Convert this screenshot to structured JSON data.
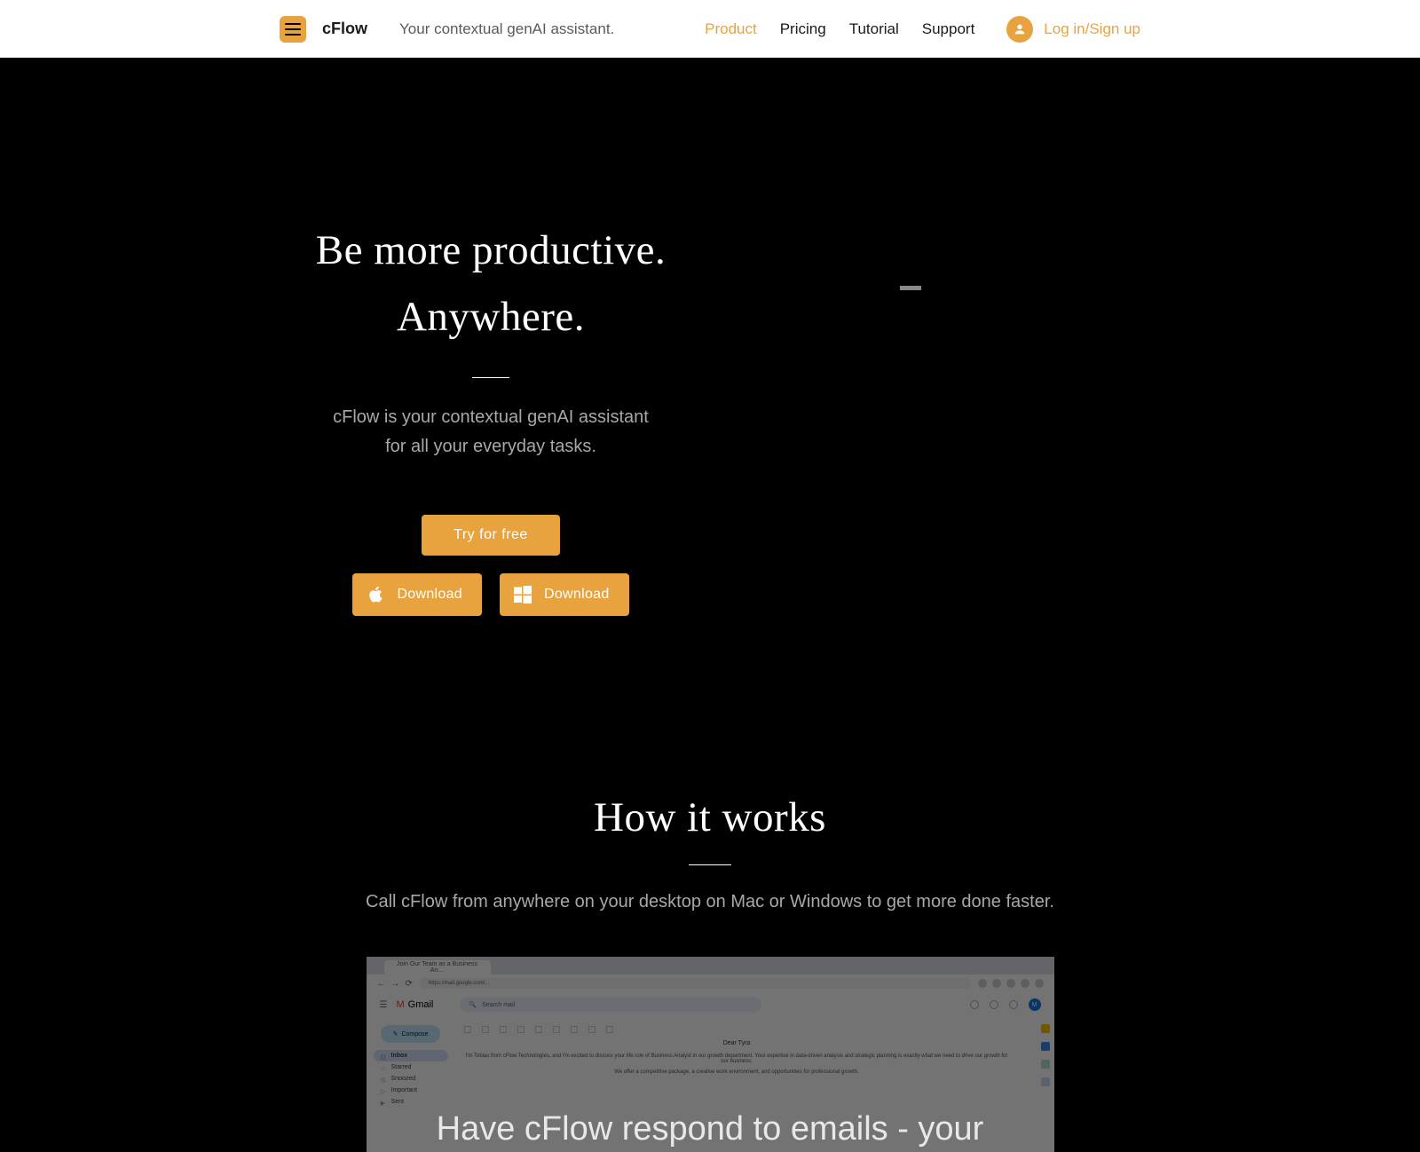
{
  "brand": {
    "name": "cFlow",
    "tagline": "Your contextual genAI assistant."
  },
  "nav": {
    "items": [
      {
        "label": "Product",
        "active": true
      },
      {
        "label": "Pricing",
        "active": false
      },
      {
        "label": "Tutorial",
        "active": false
      },
      {
        "label": "Support",
        "active": false
      }
    ],
    "login": "Log in/Sign up"
  },
  "hero": {
    "title_line1": "Be more productive.",
    "title_line2": "Anywhere.",
    "subtitle_line1": "cFlow is your contextual genAI assistant",
    "subtitle_line2": "for all your everyday tasks.",
    "try_button": "Try for free",
    "download_apple": "Download",
    "download_windows": "Download"
  },
  "how": {
    "title": "How it works",
    "subtitle": "Call cFlow from anywhere on your desktop on Mac or Windows to get more done faster."
  },
  "demo": {
    "tab_title": "Join Our Team as a Business An…",
    "url": "https://mail.google.com/...",
    "gmail_label": "Gmail",
    "search_placeholder": "Search mail",
    "compose": "Compose",
    "folders": [
      {
        "label": "Inbox",
        "active": true
      },
      {
        "label": "Starred",
        "active": false
      },
      {
        "label": "Snoozed",
        "active": false
      },
      {
        "label": "Important",
        "active": false
      },
      {
        "label": "Sent",
        "active": false
      }
    ],
    "email_greeting": "Dear Tyra",
    "email_line1": "I'm Tobias from cFlow Technologies, and I'm excited to discuss your life role of Business Analyst in our growth department. Your expertise in data-driven analysis and strategic planning is exactly what we need to drive our growth for our business.",
    "email_line2": "We offer a competitive package, a creative work environment, and opportunities for professional growth.",
    "overlay_text": "Have cFlow respond to emails - your"
  }
}
